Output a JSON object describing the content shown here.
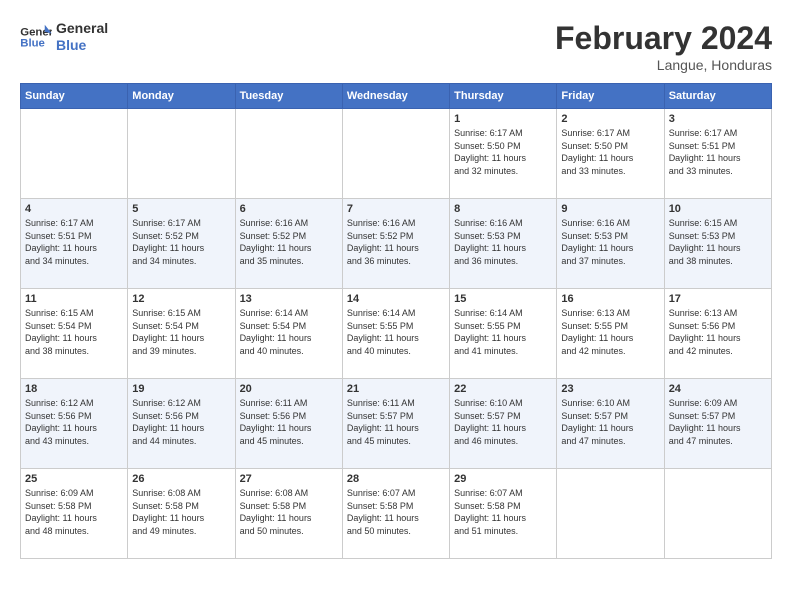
{
  "header": {
    "logo_line1": "General",
    "logo_line2": "Blue",
    "title": "February 2024",
    "subtitle": "Langue, Honduras"
  },
  "days_of_week": [
    "Sunday",
    "Monday",
    "Tuesday",
    "Wednesday",
    "Thursday",
    "Friday",
    "Saturday"
  ],
  "weeks": [
    [
      {
        "day": "",
        "info": ""
      },
      {
        "day": "",
        "info": ""
      },
      {
        "day": "",
        "info": ""
      },
      {
        "day": "",
        "info": ""
      },
      {
        "day": "1",
        "info": "Sunrise: 6:17 AM\nSunset: 5:50 PM\nDaylight: 11 hours\nand 32 minutes."
      },
      {
        "day": "2",
        "info": "Sunrise: 6:17 AM\nSunset: 5:50 PM\nDaylight: 11 hours\nand 33 minutes."
      },
      {
        "day": "3",
        "info": "Sunrise: 6:17 AM\nSunset: 5:51 PM\nDaylight: 11 hours\nand 33 minutes."
      }
    ],
    [
      {
        "day": "4",
        "info": "Sunrise: 6:17 AM\nSunset: 5:51 PM\nDaylight: 11 hours\nand 34 minutes."
      },
      {
        "day": "5",
        "info": "Sunrise: 6:17 AM\nSunset: 5:52 PM\nDaylight: 11 hours\nand 34 minutes."
      },
      {
        "day": "6",
        "info": "Sunrise: 6:16 AM\nSunset: 5:52 PM\nDaylight: 11 hours\nand 35 minutes."
      },
      {
        "day": "7",
        "info": "Sunrise: 6:16 AM\nSunset: 5:52 PM\nDaylight: 11 hours\nand 36 minutes."
      },
      {
        "day": "8",
        "info": "Sunrise: 6:16 AM\nSunset: 5:53 PM\nDaylight: 11 hours\nand 36 minutes."
      },
      {
        "day": "9",
        "info": "Sunrise: 6:16 AM\nSunset: 5:53 PM\nDaylight: 11 hours\nand 37 minutes."
      },
      {
        "day": "10",
        "info": "Sunrise: 6:15 AM\nSunset: 5:53 PM\nDaylight: 11 hours\nand 38 minutes."
      }
    ],
    [
      {
        "day": "11",
        "info": "Sunrise: 6:15 AM\nSunset: 5:54 PM\nDaylight: 11 hours\nand 38 minutes."
      },
      {
        "day": "12",
        "info": "Sunrise: 6:15 AM\nSunset: 5:54 PM\nDaylight: 11 hours\nand 39 minutes."
      },
      {
        "day": "13",
        "info": "Sunrise: 6:14 AM\nSunset: 5:54 PM\nDaylight: 11 hours\nand 40 minutes."
      },
      {
        "day": "14",
        "info": "Sunrise: 6:14 AM\nSunset: 5:55 PM\nDaylight: 11 hours\nand 40 minutes."
      },
      {
        "day": "15",
        "info": "Sunrise: 6:14 AM\nSunset: 5:55 PM\nDaylight: 11 hours\nand 41 minutes."
      },
      {
        "day": "16",
        "info": "Sunrise: 6:13 AM\nSunset: 5:55 PM\nDaylight: 11 hours\nand 42 minutes."
      },
      {
        "day": "17",
        "info": "Sunrise: 6:13 AM\nSunset: 5:56 PM\nDaylight: 11 hours\nand 42 minutes."
      }
    ],
    [
      {
        "day": "18",
        "info": "Sunrise: 6:12 AM\nSunset: 5:56 PM\nDaylight: 11 hours\nand 43 minutes."
      },
      {
        "day": "19",
        "info": "Sunrise: 6:12 AM\nSunset: 5:56 PM\nDaylight: 11 hours\nand 44 minutes."
      },
      {
        "day": "20",
        "info": "Sunrise: 6:11 AM\nSunset: 5:56 PM\nDaylight: 11 hours\nand 45 minutes."
      },
      {
        "day": "21",
        "info": "Sunrise: 6:11 AM\nSunset: 5:57 PM\nDaylight: 11 hours\nand 45 minutes."
      },
      {
        "day": "22",
        "info": "Sunrise: 6:10 AM\nSunset: 5:57 PM\nDaylight: 11 hours\nand 46 minutes."
      },
      {
        "day": "23",
        "info": "Sunrise: 6:10 AM\nSunset: 5:57 PM\nDaylight: 11 hours\nand 47 minutes."
      },
      {
        "day": "24",
        "info": "Sunrise: 6:09 AM\nSunset: 5:57 PM\nDaylight: 11 hours\nand 47 minutes."
      }
    ],
    [
      {
        "day": "25",
        "info": "Sunrise: 6:09 AM\nSunset: 5:58 PM\nDaylight: 11 hours\nand 48 minutes."
      },
      {
        "day": "26",
        "info": "Sunrise: 6:08 AM\nSunset: 5:58 PM\nDaylight: 11 hours\nand 49 minutes."
      },
      {
        "day": "27",
        "info": "Sunrise: 6:08 AM\nSunset: 5:58 PM\nDaylight: 11 hours\nand 50 minutes."
      },
      {
        "day": "28",
        "info": "Sunrise: 6:07 AM\nSunset: 5:58 PM\nDaylight: 11 hours\nand 50 minutes."
      },
      {
        "day": "29",
        "info": "Sunrise: 6:07 AM\nSunset: 5:58 PM\nDaylight: 11 hours\nand 51 minutes."
      },
      {
        "day": "",
        "info": ""
      },
      {
        "day": "",
        "info": ""
      }
    ]
  ]
}
